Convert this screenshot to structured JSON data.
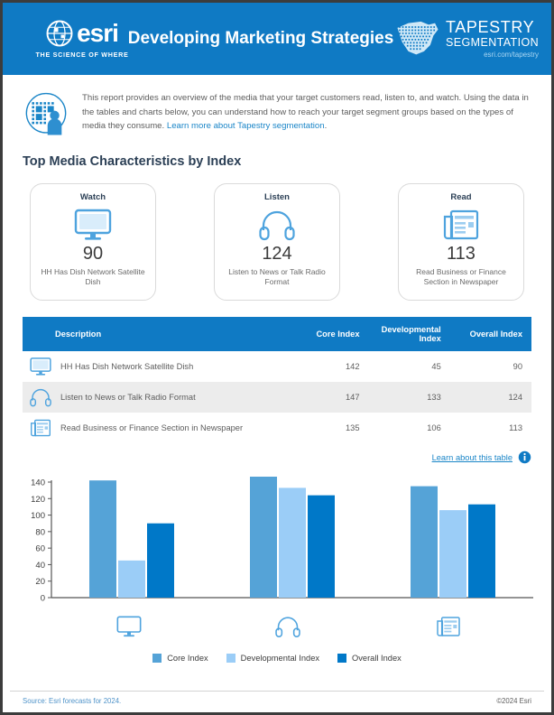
{
  "header": {
    "brand": "esri",
    "brand_tagline": "THE SCIENCE OF WHERE",
    "title": "Developing Marketing Strategies",
    "tapestry_line1": "TAPESTRY",
    "tapestry_line2": "SEGMENTATION",
    "tapestry_url": "esri.com/tapestry",
    "bg_color": "#0f7ac4"
  },
  "intro": {
    "text": "This report provides an overview of the media that your target customers read, listen to, and watch. Using the data in the tables and charts below, you can understand how to reach your target segment groups based on the types of media they consume. ",
    "link_text": "Learn more about Tapestry segmentation",
    "period": "."
  },
  "section": {
    "title": "Top Media Characteristics by Index"
  },
  "cards": [
    {
      "label": "Watch",
      "icon": "monitor-icon",
      "value": "90",
      "desc": "HH Has Dish Network Satellite Dish"
    },
    {
      "label": "Listen",
      "icon": "headphones-icon",
      "value": "124",
      "desc": "Listen to News or Talk Radio Format"
    },
    {
      "label": "Read",
      "icon": "newspaper-icon",
      "value": "113",
      "desc": "Read Business or Finance Section in Newspaper"
    }
  ],
  "table": {
    "columns": [
      "Description",
      "Core Index",
      "Developmental Index",
      "Overall Index"
    ],
    "rows": [
      {
        "icon": "monitor-icon",
        "description": "HH Has Dish Network Satellite Dish",
        "core": "142",
        "developmental": "45",
        "overall": "90"
      },
      {
        "icon": "headphones-icon",
        "description": "Listen to News or Talk Radio Format",
        "core": "147",
        "developmental": "133",
        "overall": "124"
      },
      {
        "icon": "newspaper-icon",
        "description": "Read Business or Finance Section in Newspaper",
        "core": "135",
        "developmental": "106",
        "overall": "113"
      }
    ],
    "learn_link": "Learn about this table",
    "info_icon": "info-icon"
  },
  "chart_data": {
    "type": "bar",
    "title": "",
    "categories": [
      "Watch",
      "Listen",
      "Read"
    ],
    "category_icons": [
      "monitor-icon",
      "headphones-icon",
      "newspaper-icon"
    ],
    "series": [
      {
        "name": "Core Index",
        "values": [
          142,
          147,
          135
        ],
        "color": "#55a3d7"
      },
      {
        "name": "Developmental Index",
        "values": [
          45,
          133,
          106
        ],
        "color": "#9bcdf7"
      },
      {
        "name": "Overall Index",
        "values": [
          90,
          124,
          113
        ],
        "color": "#0078c8"
      }
    ],
    "ylim": [
      0,
      140
    ],
    "yticks": [
      0,
      20,
      40,
      60,
      80,
      100,
      120,
      140
    ],
    "xlabel": "",
    "ylabel": "",
    "grid": false,
    "legend_position": "bottom"
  },
  "footer": {
    "source": "Source: Esri forecasts for 2024.",
    "copyright": "©2024 Esri"
  }
}
